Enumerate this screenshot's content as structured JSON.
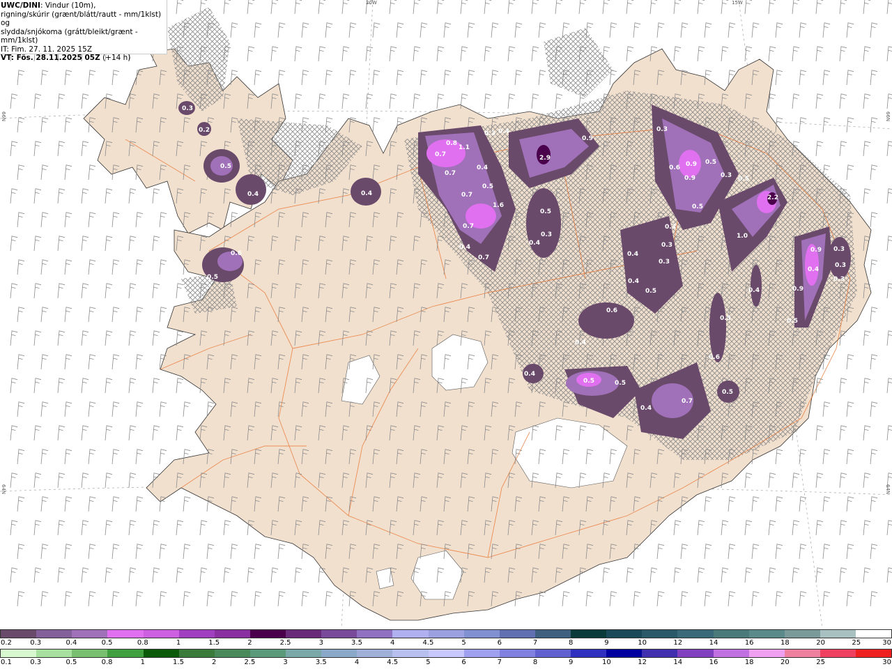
{
  "title": {
    "source": "UWC/DINI",
    "line1": ": Vindur (10m),",
    "line2": "rigning/skúrir (grænt/blátt/rautt - mm/1klst) og",
    "line3": "slydda/snjókoma (grátt/bleikt/grænt - mm/1klst)",
    "init": "IT: Fim. 27. 11. 2025 15Z",
    "valid": "VT: Fös. 28.11.2025 05Z",
    "lead": " (+14 h)"
  },
  "gridlabels": {
    "lon20": "20W",
    "lon15": "15W",
    "lat66_left": "66N",
    "lat66_right": "66N",
    "lat64_left": "64N",
    "lat64_right": "64N"
  },
  "snow_values": [
    {
      "v": "0.3"
    },
    {
      "v": "0.2"
    },
    {
      "v": "0.5"
    },
    {
      "v": "0.4"
    },
    {
      "v": "0.6"
    },
    {
      "v": "0.5"
    },
    {
      "v": "0.4"
    },
    {
      "v": "0.7"
    },
    {
      "v": "0.8"
    },
    {
      "v": "1.1"
    },
    {
      "v": "0.7"
    },
    {
      "v": "0.3"
    },
    {
      "v": "0.4"
    },
    {
      "v": "2.9"
    },
    {
      "v": "0.9"
    },
    {
      "v": "0.4"
    },
    {
      "v": "0.5"
    },
    {
      "v": "0.7"
    },
    {
      "v": "1.6"
    },
    {
      "v": "0.7"
    },
    {
      "v": "0.4"
    },
    {
      "v": "0.7"
    },
    {
      "v": "0.5"
    },
    {
      "v": "0.3"
    },
    {
      "v": "0.4"
    },
    {
      "v": "0.3"
    },
    {
      "v": "0.6"
    },
    {
      "v": "0.9"
    },
    {
      "v": "0.5"
    },
    {
      "v": "0.9"
    },
    {
      "v": "0.3"
    },
    {
      "v": "0.5"
    },
    {
      "v": "0.5"
    },
    {
      "v": "2.2"
    },
    {
      "v": "1.0"
    },
    {
      "v": "0.3"
    },
    {
      "v": "0.3"
    },
    {
      "v": "0.4"
    },
    {
      "v": "0.3"
    },
    {
      "v": "0.4"
    },
    {
      "v": "0.5"
    },
    {
      "v": "0.6"
    },
    {
      "v": "0.4"
    },
    {
      "v": "0.4"
    },
    {
      "v": "0.5"
    },
    {
      "v": "0.6"
    },
    {
      "v": "0.4"
    },
    {
      "v": "0.5"
    },
    {
      "v": "0.5"
    },
    {
      "v": "0.4"
    },
    {
      "v": "0.7"
    },
    {
      "v": "0.5"
    },
    {
      "v": "0.9"
    },
    {
      "v": "0.4"
    },
    {
      "v": "0.3"
    },
    {
      "v": "0.3"
    },
    {
      "v": "0.3"
    },
    {
      "v": "0.9"
    },
    {
      "v": "0.5"
    }
  ],
  "legend_snow": {
    "colors": [
      "#6a4a6a",
      "#84609a",
      "#a070b8",
      "#e070f0",
      "#cc60e0",
      "#a040c0",
      "#8a30a0",
      "#4a004a",
      "#6a2a7a",
      "#7a4a9a",
      "#9070c0",
      "#b0b0f0",
      "#9aa0e0",
      "#8090d0",
      "#6070b0",
      "#406080",
      "#0a3a3a",
      "#1a4a5a",
      "#2a5a6a",
      "#3a6a7a",
      "#4a7a7a",
      "#5a8a8a",
      "#7a9a9a",
      "#a8c0c0",
      "#ffffff"
    ],
    "labels": [
      "0.2",
      "0.3",
      "0.4",
      "0.5",
      "0.8",
      "1",
      "1.5",
      "2",
      "2.5",
      "3",
      "3.5",
      "4",
      "4.5",
      "5",
      "6",
      "7",
      "8",
      "9",
      "10",
      "12",
      "14",
      "16",
      "18",
      "20",
      "25",
      "30"
    ]
  },
  "legend_rain": {
    "colors": [
      "#d8f8d0",
      "#a8e0a0",
      "#78c070",
      "#40a040",
      "#0a5a0a",
      "#3a7a3a",
      "#4a8a5a",
      "#5a9a7a",
      "#7aa8a8",
      "#8aa8c8",
      "#a0b0d8",
      "#b8c0f0",
      "#c8c8ff",
      "#a0a0f0",
      "#8080e0",
      "#6060d0",
      "#3030c0",
      "#0000a0",
      "#4030b0",
      "#8040c0",
      "#c070e0",
      "#f0a0f0",
      "#f080a0",
      "#f04060",
      "#f02020"
    ],
    "labels": [
      "0.1",
      "0.3",
      "0.5",
      "0.8",
      "1",
      "1.5",
      "2",
      "2.5",
      "3",
      "3.5",
      "4",
      "4.5",
      "5",
      "6",
      "7",
      "8",
      "9",
      "10",
      "12",
      "14",
      "16",
      "18",
      "20",
      "25",
      "30"
    ]
  },
  "colors": {
    "land": "#f2e0cf",
    "roads": "#e8702a",
    "glacier": "#ffffff",
    "wind": "#8a8a8a"
  }
}
